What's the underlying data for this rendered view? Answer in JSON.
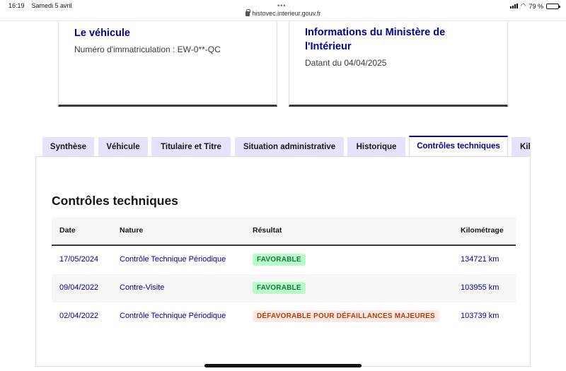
{
  "status_bar": {
    "time": "16:19",
    "date": "Samedi 5 avril",
    "dots": "•••",
    "url": "histovec.interieur.gouv.fr",
    "battery": "79 %",
    "battery_level": 0.79
  },
  "cards": {
    "vehicle": {
      "title": "Le véhicule",
      "plate_text": "Numéro d'immatriculation : EW-0**-QC"
    },
    "ministere": {
      "title": "Informations du Ministère de l'Intérieur",
      "date_text": "Datant du 04/04/2025"
    }
  },
  "tabs": [
    {
      "label": "Synthèse",
      "active": false
    },
    {
      "label": "Véhicule",
      "active": false
    },
    {
      "label": "Titulaire et Titre",
      "active": false
    },
    {
      "label": "Situation administrative",
      "active": false
    },
    {
      "label": "Historique",
      "active": false
    },
    {
      "label": "Contrôles techniques",
      "active": true
    },
    {
      "label": "Kilométrage",
      "active": false
    }
  ],
  "section": {
    "title": "Contrôles techniques",
    "columns": [
      "Date",
      "Nature",
      "Résultat",
      "Kilométrage"
    ],
    "rows": [
      {
        "date": "17/05/2024",
        "nature": "Contrôle Technique Périodique",
        "result": "FAVORABLE",
        "result_type": "ok",
        "km": "134721 km"
      },
      {
        "date": "09/04/2022",
        "nature": "Contre-Visite",
        "result": "FAVORABLE",
        "result_type": "ok",
        "km": "103955 km"
      },
      {
        "date": "02/04/2022",
        "nature": "Contrôle Technique Périodique",
        "result": "DÉFAVORABLE POUR DÉFAILLANCES MAJEURES",
        "result_type": "ko",
        "km": "103739 km"
      }
    ]
  },
  "colors": {
    "primary": "#000091",
    "tab_bg": "#e3e3fd",
    "success_bg": "#b8fec9",
    "success_text": "#18753c",
    "error_bg": "#ffe9e6",
    "error_text": "#b34000"
  }
}
